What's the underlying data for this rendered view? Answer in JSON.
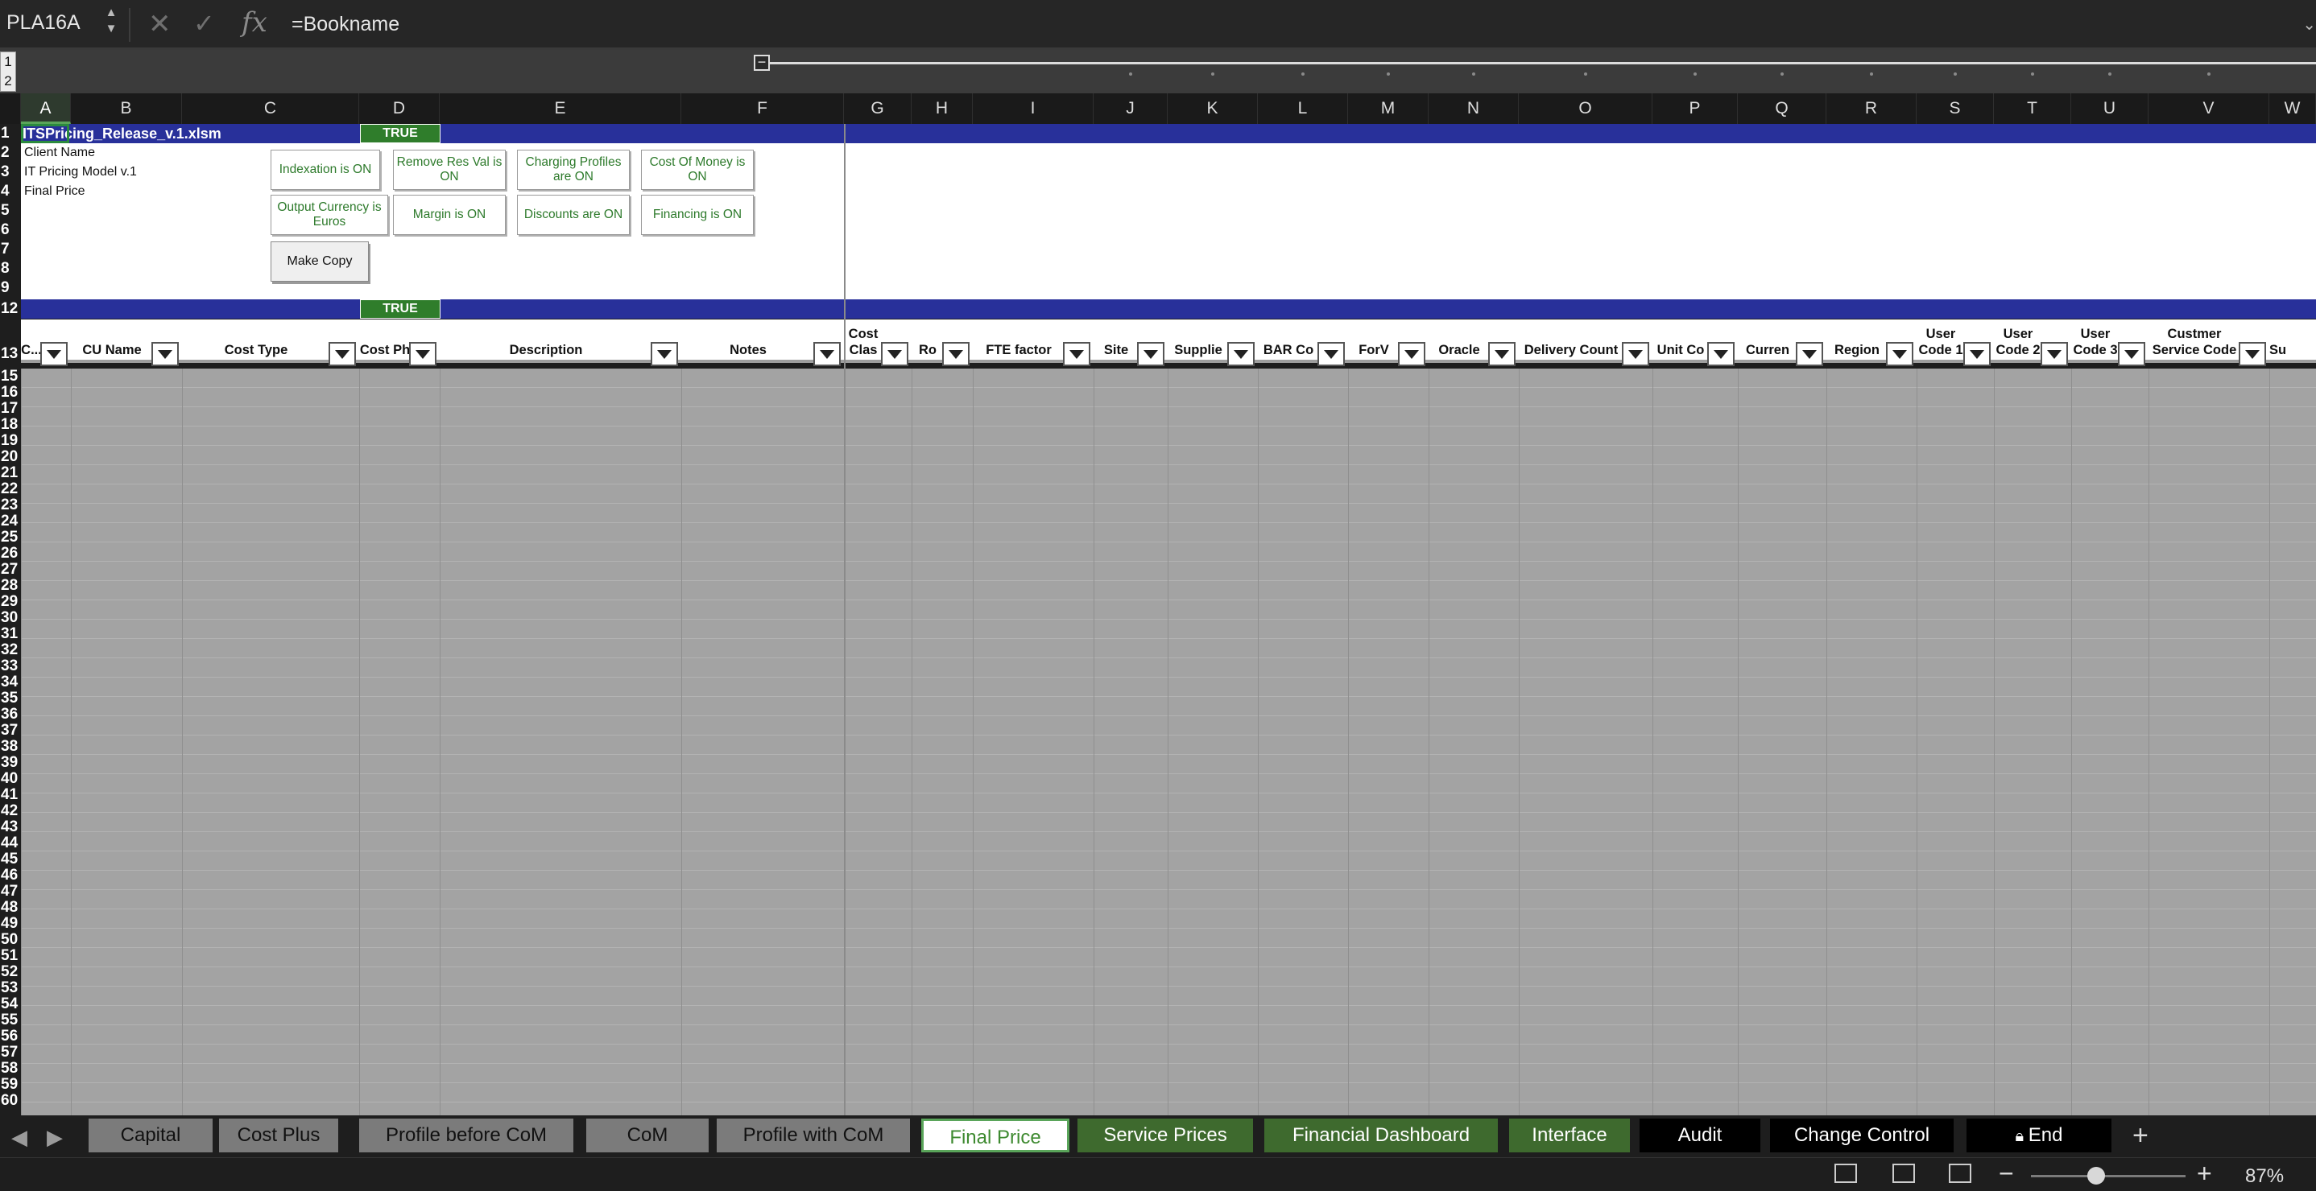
{
  "formula_bar": {
    "name_box": "PLA16A",
    "fx": "fx",
    "formula": "=Bookname"
  },
  "grouping": {
    "levels": [
      "1",
      "2"
    ],
    "collapse": "−"
  },
  "columns": [
    "A",
    "B",
    "C",
    "D",
    "E",
    "F",
    "G",
    "H",
    "I",
    "J",
    "K",
    "L",
    "M",
    "N",
    "O",
    "P",
    "Q",
    "R",
    "S",
    "T",
    "U",
    "V",
    "W"
  ],
  "selected_column": "A",
  "rows": {
    "top": [
      "1",
      "2",
      "3",
      "4",
      "5",
      "6",
      "7",
      "8",
      "9",
      "12"
    ],
    "header": "13",
    "data": [
      "15",
      "16",
      "17",
      "18",
      "19",
      "20",
      "21",
      "22",
      "23",
      "24",
      "25",
      "26",
      "27",
      "28",
      "29",
      "30",
      "31",
      "32",
      "33",
      "34",
      "35",
      "36",
      "37",
      "38",
      "39",
      "40",
      "41",
      "42",
      "43",
      "44",
      "45",
      "46",
      "47",
      "48",
      "49",
      "50",
      "51",
      "52",
      "53",
      "54",
      "55",
      "56",
      "57",
      "58",
      "59",
      "60"
    ]
  },
  "sheet": {
    "a1": "ITSPricing_Release_v.1.xlsm",
    "labels": [
      "Client Name",
      "IT Pricing Model v.1",
      "Final Price"
    ],
    "flag_d1": "TRUE",
    "flag_d12": "TRUE",
    "toggles": [
      "Indexation is ON",
      "Remove Res Val is ON",
      "Charging Profiles are ON",
      "Cost Of Money is ON",
      "Output Currency is Euros",
      "Margin is ON",
      "Discounts are ON",
      "Financing is ON"
    ],
    "make_copy": "Make Copy"
  },
  "table_headers": [
    "C...",
    "CU Name",
    "Cost Type",
    "Cost Ph",
    "Description",
    "Notes",
    "Cost Clas",
    "Ro",
    "FTE factor",
    "Site",
    "Supplie",
    "BAR Co",
    "ForV",
    "Oracle",
    "Delivery Count",
    "Unit Co",
    "Curren",
    "Region",
    "User Code 1",
    "User Code 2",
    "User Code 3",
    "Custmer Service Code",
    "Sub-Co"
  ],
  "tabs": [
    "Capital",
    "Cost Plus",
    "Profile before CoM",
    "CoM",
    "Profile with CoM",
    "Final Price",
    "Service Prices",
    "Financial Dashboard",
    "Interface",
    "Audit",
    "Change Control",
    "End"
  ],
  "active_tab": "Final Price",
  "zoom": "87%"
}
